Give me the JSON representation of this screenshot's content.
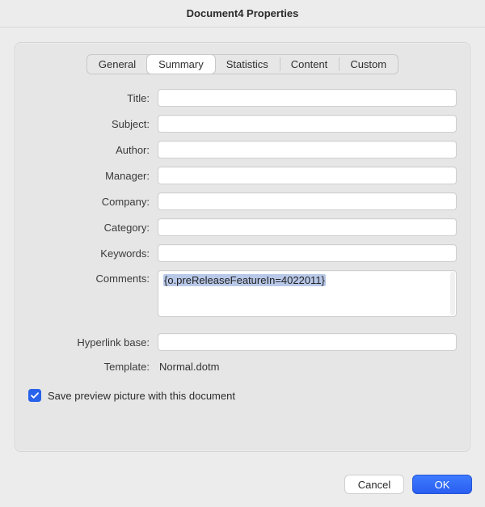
{
  "window": {
    "title": "Document4 Properties"
  },
  "tabs": {
    "items": [
      {
        "label": "General"
      },
      {
        "label": "Summary"
      },
      {
        "label": "Statistics"
      },
      {
        "label": "Content"
      },
      {
        "label": "Custom"
      }
    ],
    "active_index": 1
  },
  "summary": {
    "labels": {
      "title": "Title:",
      "subject": "Subject:",
      "author": "Author:",
      "manager": "Manager:",
      "company": "Company:",
      "category": "Category:",
      "keywords": "Keywords:",
      "comments": "Comments:",
      "hyperlink_base": "Hyperlink base:",
      "template": "Template:"
    },
    "values": {
      "title": "",
      "subject": "",
      "author": "",
      "manager": "",
      "company": "",
      "category": "",
      "keywords": "",
      "comments": "{o.preReleaseFeatureIn=4022011}",
      "hyperlink_base": "",
      "template": "Normal.dotm"
    },
    "save_preview": {
      "checked": true,
      "label": "Save preview picture with this document"
    }
  },
  "buttons": {
    "cancel": "Cancel",
    "ok": "OK"
  }
}
